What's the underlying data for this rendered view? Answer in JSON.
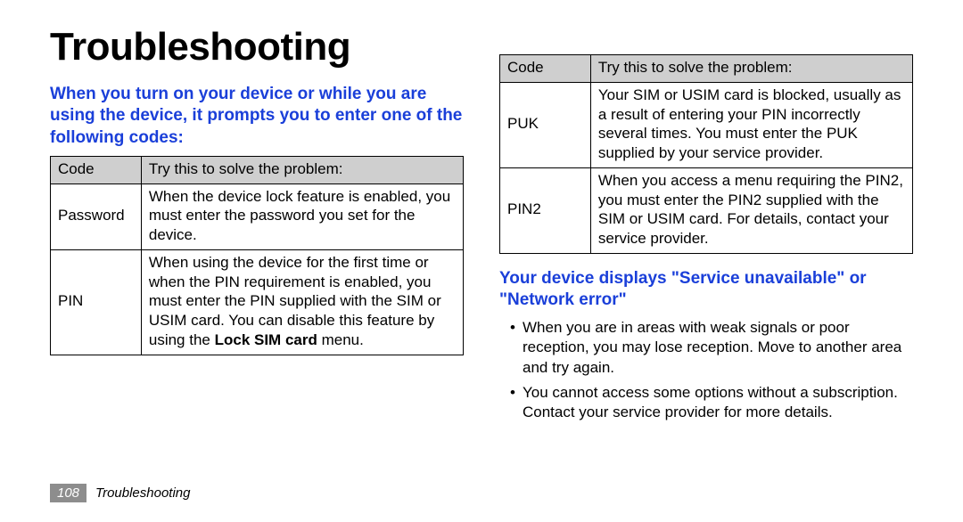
{
  "title": "Troubleshooting",
  "section1": {
    "heading": "When you turn on your device or while you are using the device, it prompts you to enter one of the following codes:",
    "table": {
      "headers": {
        "code": "Code",
        "desc": "Try this to solve the problem:"
      },
      "rows": [
        {
          "code": "Password",
          "desc": "When the device lock feature is enabled, you must enter the password you set for the device."
        },
        {
          "code": "PIN",
          "desc_pre": "When using the device for the first time or when the PIN requirement is enabled, you must enter the PIN supplied with the SIM or USIM card. You can disable this feature by using the ",
          "desc_bold": "Lock SIM card",
          "desc_post": " menu."
        }
      ]
    }
  },
  "table2": {
    "headers": {
      "code": "Code",
      "desc": "Try this to solve the problem:"
    },
    "rows": [
      {
        "code": "PUK",
        "desc": "Your SIM or USIM card is blocked, usually as a result of entering your PIN incorrectly several times. You must enter the PUK supplied by your service provider."
      },
      {
        "code": "PIN2",
        "desc": "When you access a menu requiring the PIN2, you must enter the PIN2 supplied with the SIM or USIM card. For details, contact your service provider."
      }
    ]
  },
  "section2": {
    "heading": "Your device displays \"Service unavailable\" or \"Network error\"",
    "bullets": [
      "When you are in areas with weak signals or poor reception, you may lose reception. Move to another area and try again.",
      "You cannot access some options without a subscription. Contact your service provider for more details."
    ]
  },
  "footer": {
    "page": "108",
    "label": "Troubleshooting"
  }
}
